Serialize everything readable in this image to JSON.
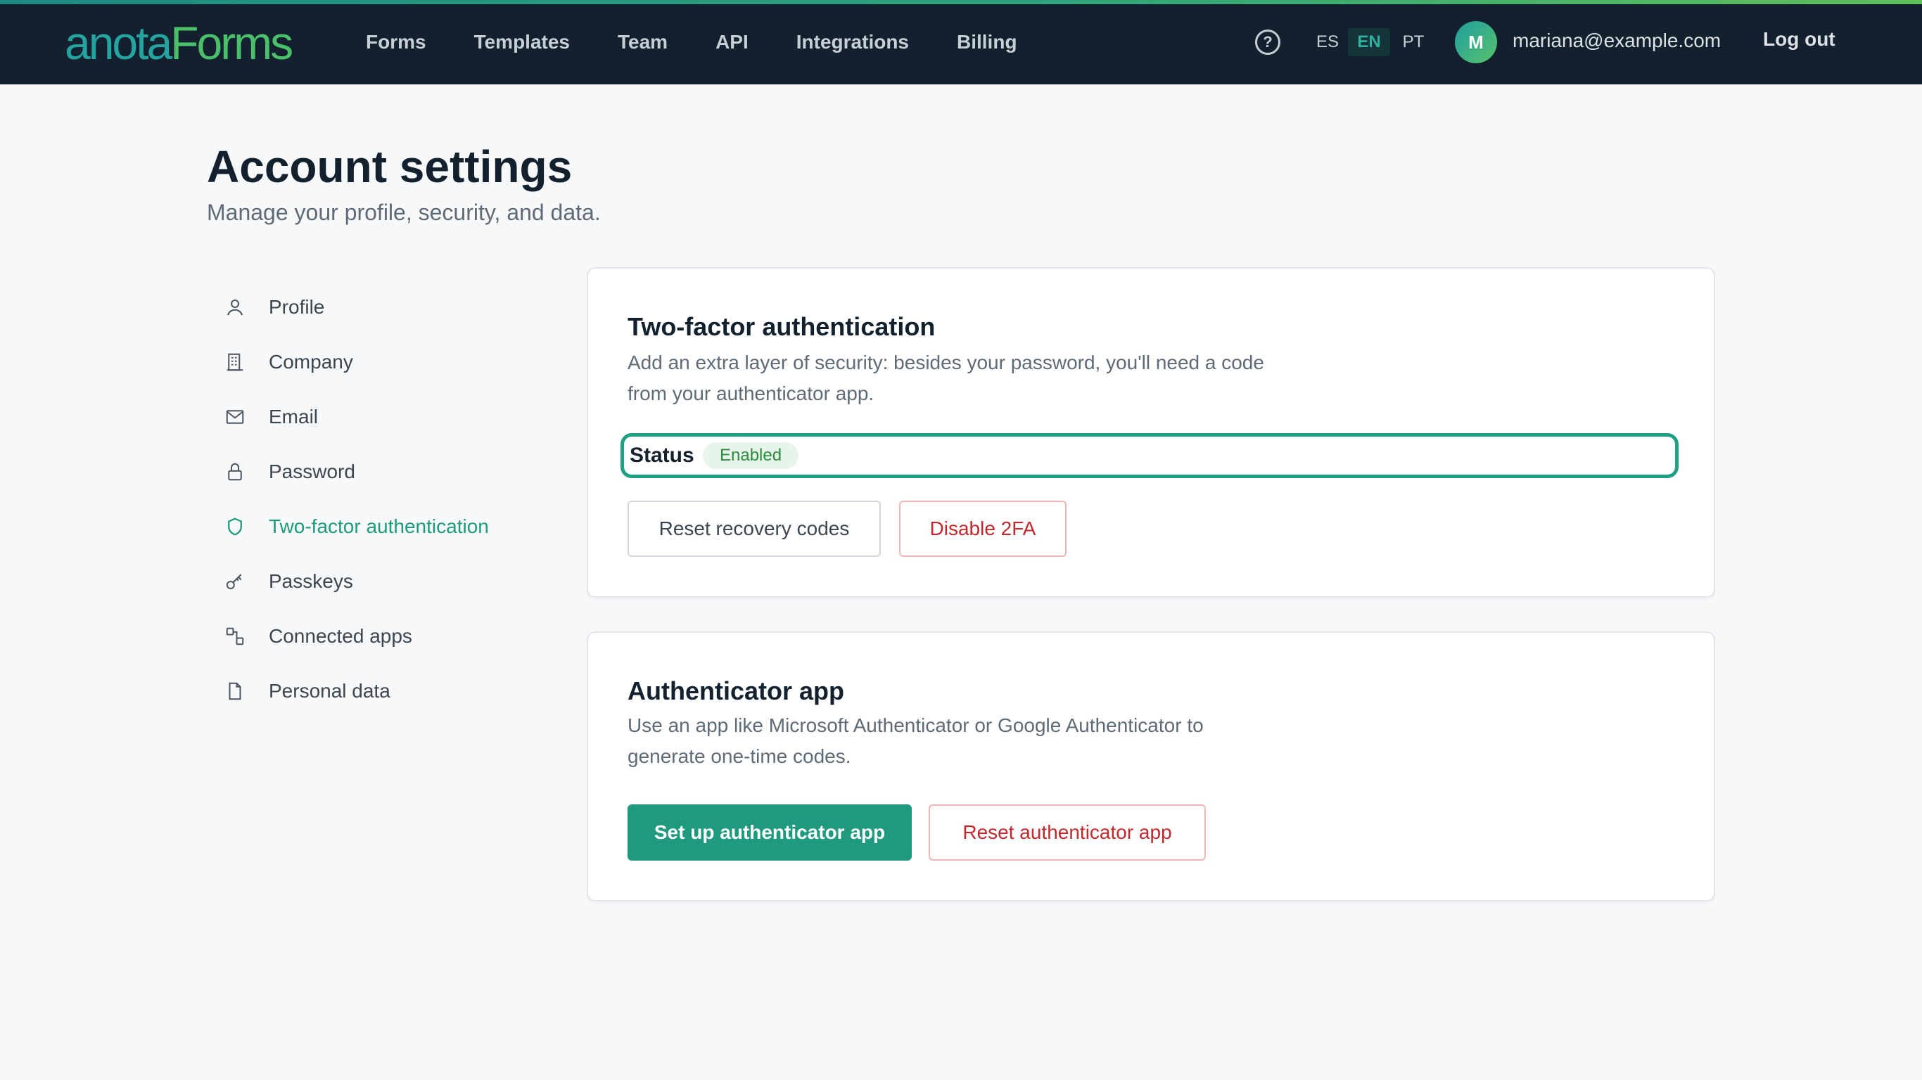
{
  "brand": {
    "part1": "anota",
    "part2": "Forms"
  },
  "nav": {
    "items": [
      "Forms",
      "Templates",
      "Team",
      "API",
      "Integrations",
      "Billing"
    ]
  },
  "header_right": {
    "help_icon": "help-circle-icon",
    "languages": [
      "ES",
      "EN",
      "PT"
    ],
    "active_language": "EN",
    "avatar_initial": "M",
    "user_email": "mariana@example.com",
    "logout_label": "Log out"
  },
  "page": {
    "title": "Account settings",
    "subtitle": "Manage your profile, security, and data."
  },
  "sidebar": {
    "items": [
      {
        "label": "Profile",
        "icon": "user-icon"
      },
      {
        "label": "Company",
        "icon": "building-icon"
      },
      {
        "label": "Email",
        "icon": "mail-icon"
      },
      {
        "label": "Password",
        "icon": "lock-icon"
      },
      {
        "label": "Two-factor authentication",
        "icon": "shield-icon"
      },
      {
        "label": "Passkeys",
        "icon": "key-icon"
      },
      {
        "label": "Connected apps",
        "icon": "apps-icon"
      },
      {
        "label": "Personal data",
        "icon": "file-icon"
      }
    ],
    "active_index": 4
  },
  "two_factor": {
    "title": "Two-factor authentication",
    "description_line1": "Add an extra layer of security: besides your password, you'll need a code",
    "description_line2": "from your authenticator app.",
    "status_label": "Status",
    "status_value": "Enabled",
    "reset_codes_label": "Reset recovery codes",
    "disable_label": "Disable 2FA"
  },
  "authenticator": {
    "title": "Authenticator app",
    "description_line1": "Use an app like Microsoft Authenticator or Google Authenticator to",
    "description_line2": "generate one-time codes.",
    "setup_label": "Set up authenticator app",
    "reset_label": "Reset authenticator app"
  },
  "colors": {
    "topbar": "#13212e",
    "accent": "#1f9a7e",
    "danger": "#c2282c",
    "badge_bg": "#e6f4ea",
    "badge_text": "#2e8b3e"
  }
}
